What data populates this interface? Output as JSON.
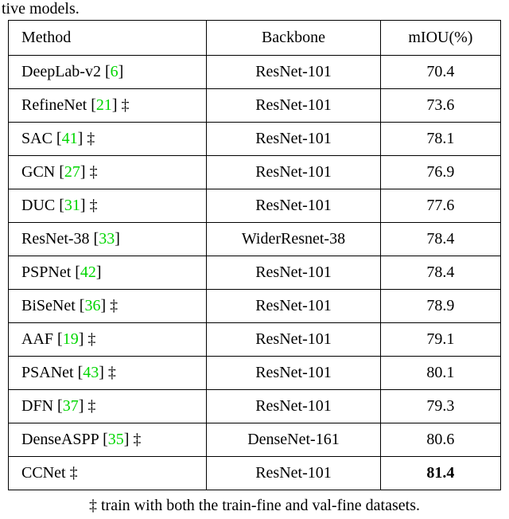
{
  "caption_fragment": "tive models.",
  "headers": {
    "method": "Method",
    "backbone": "Backbone",
    "miou": "mIOU(%)"
  },
  "rows": [
    {
      "name": "DeepLab-v2 ",
      "cite": "6",
      "dagger": false,
      "backbone": "ResNet-101",
      "miou": "70.4"
    },
    {
      "name": "RefineNet ",
      "cite": "21",
      "dagger": true,
      "backbone": "ResNet-101",
      "miou": "73.6"
    },
    {
      "name": "SAC ",
      "cite": "41",
      "dagger": true,
      "backbone": "ResNet-101",
      "miou": "78.1"
    },
    {
      "name": "GCN ",
      "cite": "27",
      "dagger": true,
      "backbone": "ResNet-101",
      "miou": "76.9"
    },
    {
      "name": "DUC ",
      "cite": "31",
      "dagger": true,
      "backbone": "ResNet-101",
      "miou": "77.6"
    },
    {
      "name": "ResNet-38 ",
      "cite": "33",
      "dagger": false,
      "backbone": "WiderResnet-38",
      "miou": "78.4"
    },
    {
      "name": "PSPNet ",
      "cite": "42",
      "dagger": false,
      "backbone": "ResNet-101",
      "miou": "78.4"
    },
    {
      "name": "BiSeNet ",
      "cite": "36",
      "dagger": true,
      "backbone": "ResNet-101",
      "miou": "78.9"
    },
    {
      "name": "AAF ",
      "cite": "19",
      "dagger": true,
      "backbone": "ResNet-101",
      "miou": "79.1"
    },
    {
      "name": "PSANet ",
      "cite": "43",
      "dagger": true,
      "backbone": "ResNet-101",
      "miou": "80.1"
    },
    {
      "name": "DFN ",
      "cite": "37",
      "dagger": true,
      "backbone": "ResNet-101",
      "miou": "79.3"
    },
    {
      "name": "DenseASPP ",
      "cite": "35",
      "dagger": true,
      "backbone": "DenseNet-161",
      "miou": "80.6"
    }
  ],
  "final_row": {
    "name": "CCNet ",
    "dagger": true,
    "backbone": "ResNet-101",
    "miou": "81.4"
  },
  "footnote": "‡ train with both the train-fine and val-fine datasets.",
  "chart_data": {
    "type": "table",
    "title": "Comparison of segmentation methods",
    "columns": [
      "Method",
      "Backbone",
      "mIOU(%)"
    ],
    "data": [
      [
        "DeepLab-v2 [6]",
        "ResNet-101",
        70.4
      ],
      [
        "RefineNet [21] ‡",
        "ResNet-101",
        73.6
      ],
      [
        "SAC [41] ‡",
        "ResNet-101",
        78.1
      ],
      [
        "GCN [27] ‡",
        "ResNet-101",
        76.9
      ],
      [
        "DUC [31] ‡",
        "ResNet-101",
        77.6
      ],
      [
        "ResNet-38 [33]",
        "WiderResnet-38",
        78.4
      ],
      [
        "PSPNet [42]",
        "ResNet-101",
        78.4
      ],
      [
        "BiSeNet [36] ‡",
        "ResNet-101",
        78.9
      ],
      [
        "AAF [19] ‡",
        "ResNet-101",
        79.1
      ],
      [
        "PSANet [43] ‡",
        "ResNet-101",
        80.1
      ],
      [
        "DFN [37] ‡",
        "ResNet-101",
        79.3
      ],
      [
        "DenseASPP [35] ‡",
        "DenseNet-161",
        80.6
      ],
      [
        "CCNet ‡",
        "ResNet-101",
        81.4
      ]
    ]
  }
}
